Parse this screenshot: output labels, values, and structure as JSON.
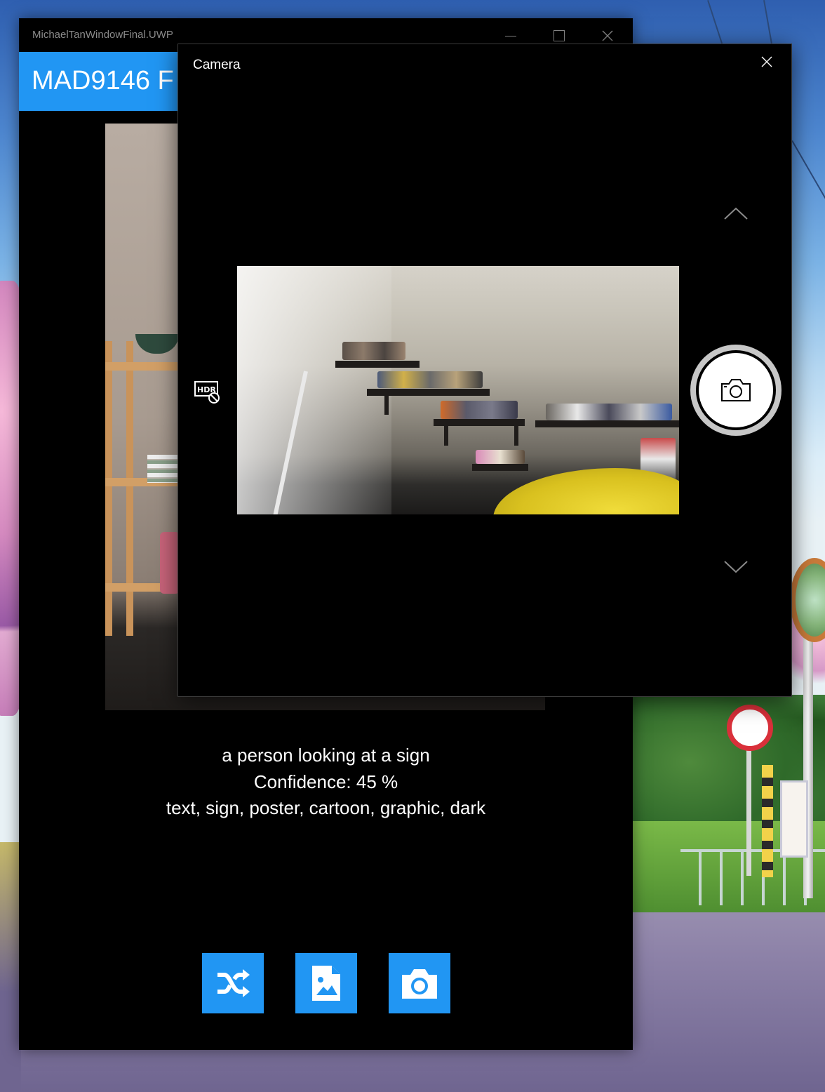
{
  "app_window": {
    "title": "MichaelTanWindowFinal.UWP",
    "header_title": "MAD9146 F",
    "caption": {
      "description": "a person looking at a sign",
      "confidence": "Confidence: 45 %",
      "tags": "text, sign, poster, cartoon, graphic, dark"
    },
    "buttons": [
      {
        "name": "shuffle",
        "icon": "shuffle-icon"
      },
      {
        "name": "pick-image",
        "icon": "image-file-icon"
      },
      {
        "name": "camera",
        "icon": "camera-icon"
      }
    ],
    "accent_color": "#2196F3"
  },
  "camera_dialog": {
    "title": "Camera",
    "controls": {
      "close": "close-icon",
      "hdr": "hdr-off-icon",
      "scroll_up": "chevron-up-icon",
      "scroll_down": "chevron-down-icon",
      "capture": "camera-icon"
    }
  }
}
